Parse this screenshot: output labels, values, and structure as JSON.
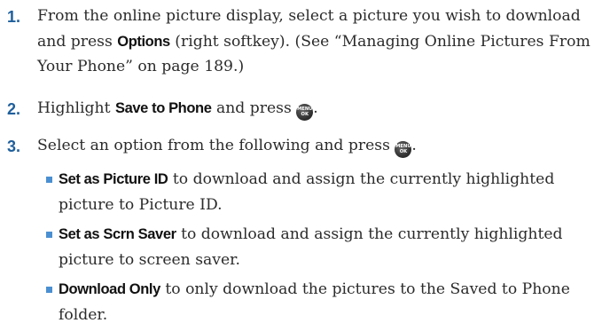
{
  "steps": [
    {
      "number": "1.",
      "text_before": "From the online picture display, select a picture you wish to download and press ",
      "bold": "Options",
      "text_after": " (right softkey). (See “Managing Online Pictures From Your Phone” on page 189.)"
    },
    {
      "number": "2.",
      "text_before": "Highlight ",
      "bold": "Save to Phone",
      "text_after": " and press "
    },
    {
      "number": "3.",
      "text_before": "Select an option from the following and press "
    }
  ],
  "key_icon": {
    "name": "menu-ok-key-icon",
    "line1": "MENU",
    "line2": "OK"
  },
  "options": [
    {
      "bold": "Set as Picture ID",
      "text": " to download and assign the currently highlighted picture to Picture ID."
    },
    {
      "bold": "Set as Scrn Saver",
      "text": " to download and assign the currently highlighted picture to screen saver."
    },
    {
      "bold": "Download Only",
      "text": " to only download the pictures to the Saved to Phone folder."
    }
  ],
  "colors": {
    "step_number": "#1f5f9c",
    "bullet": "#4a8fd0",
    "text": "#2b2b2b"
  }
}
